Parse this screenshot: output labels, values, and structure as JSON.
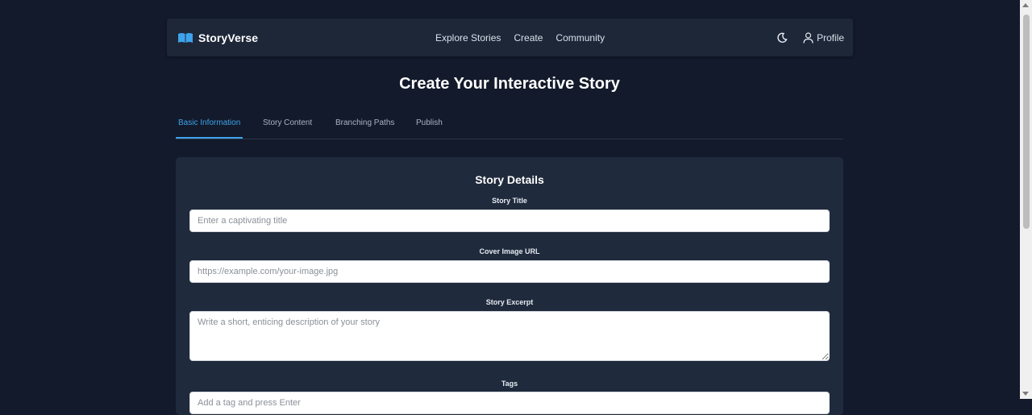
{
  "app": {
    "brand": "StoryVerse",
    "nav": [
      "Explore Stories",
      "Create",
      "Community"
    ],
    "profile_label": "Profile"
  },
  "page": {
    "title": "Create Your Interactive Story"
  },
  "tabs": [
    {
      "label": "Basic Information",
      "active": true
    },
    {
      "label": "Story Content",
      "active": false
    },
    {
      "label": "Branching Paths",
      "active": false
    },
    {
      "label": "Publish",
      "active": false
    }
  ],
  "form": {
    "section_title": "Story Details",
    "fields": {
      "title": {
        "label": "Story Title",
        "placeholder": "Enter a captivating title",
        "value": ""
      },
      "cover": {
        "label": "Cover Image URL",
        "placeholder": "https://example.com/your-image.jpg",
        "value": ""
      },
      "excerpt": {
        "label": "Story Excerpt",
        "placeholder": "Write a short, enticing description of your story",
        "value": ""
      },
      "tags": {
        "label": "Tags",
        "placeholder": "Add a tag and press Enter",
        "value": ""
      }
    }
  },
  "icons": {
    "brand": "open-book-icon",
    "theme_toggle": "moon-icon",
    "profile": "user-icon"
  },
  "colors": {
    "background": "#121a2b",
    "navbar": "#1d2738",
    "card": "#1f2a3c",
    "accent": "#3fa3ec"
  }
}
